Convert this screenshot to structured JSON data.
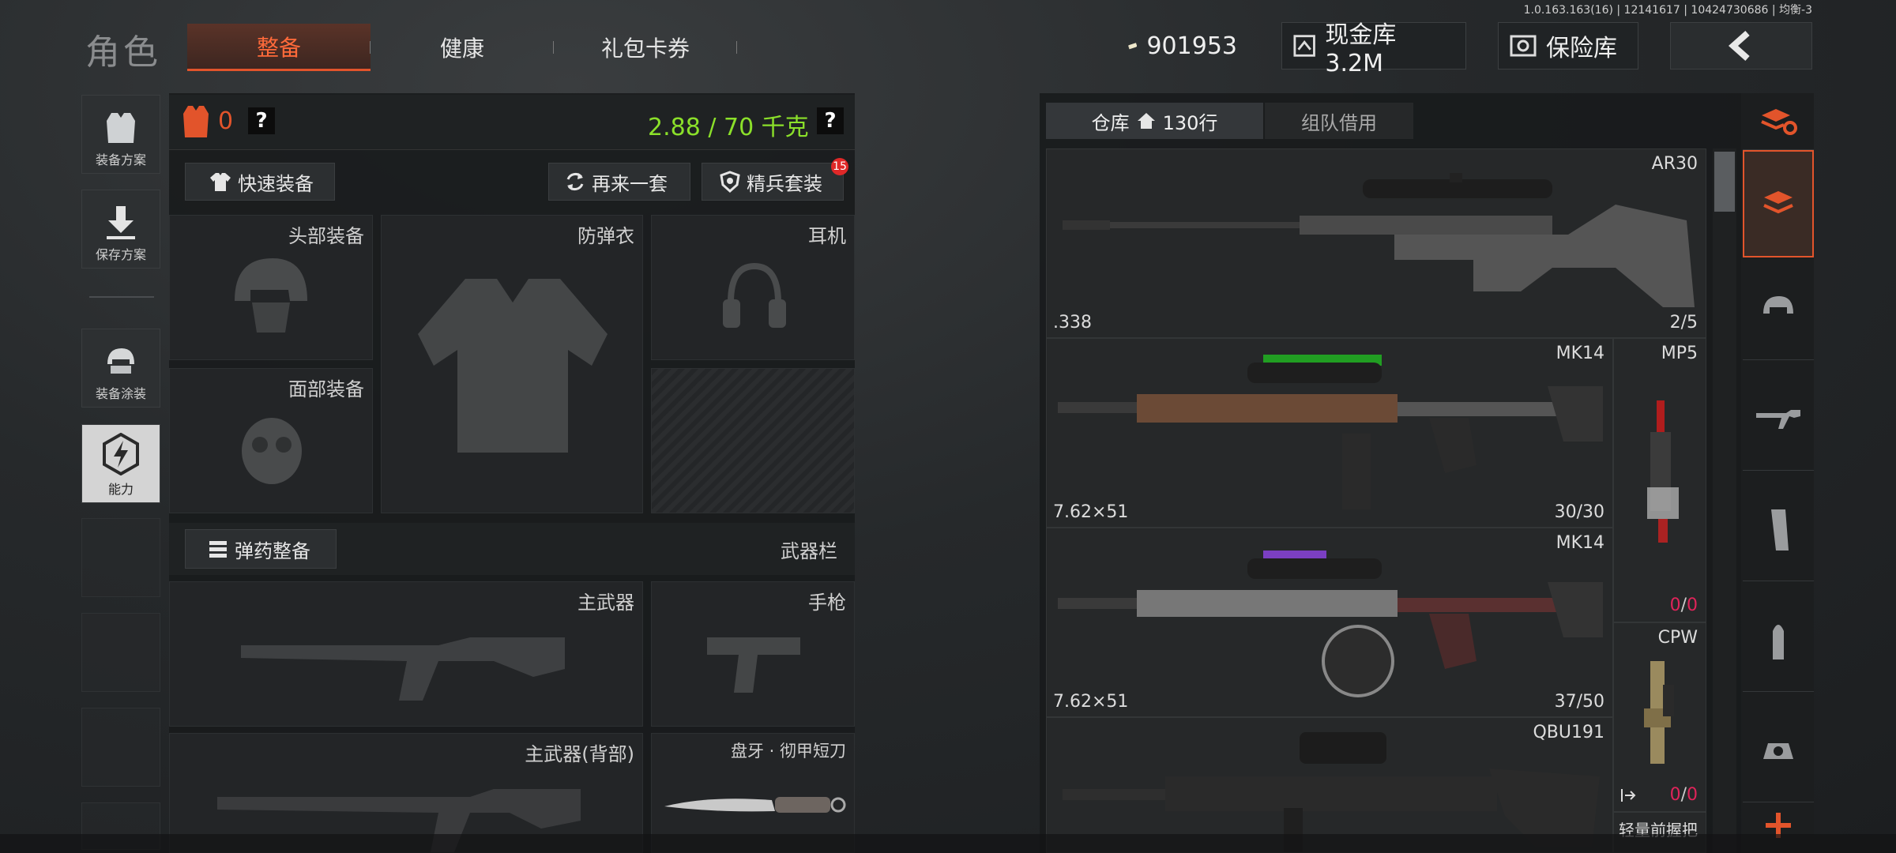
{
  "header": {
    "page_title": "角色",
    "tabs": [
      {
        "label": "整备",
        "active": true
      },
      {
        "label": "健康",
        "active": false
      },
      {
        "label": "礼包卡券",
        "active": false
      }
    ],
    "version_text": "1.0.163.163(16) | 12141617 | 10424730686 | 均衡-3",
    "money": "901953",
    "cash_vault": "现金库 3.2M",
    "safe_box": "保险库",
    "accent_color": "#e2542b"
  },
  "sidebar": {
    "items": [
      {
        "label": "装备方案",
        "icon": "vest-icon"
      },
      {
        "label": "保存方案",
        "icon": "download-icon"
      },
      {
        "label": "装备涂装",
        "icon": "helmet-icon"
      },
      {
        "label": "能力",
        "icon": "lightning-icon"
      }
    ]
  },
  "loadout": {
    "armor_count": "0",
    "help_mark": "?",
    "weight": "2.88 / 70 千克",
    "quick_equip": "快速装备",
    "again": "再来一套",
    "elite_kit": "精兵套装",
    "elite_badge": "15",
    "slots": {
      "head": "头部装备",
      "vest": "防弹衣",
      "headset": "耳机",
      "face": "面部装备",
      "primary": "主武器",
      "pistol": "手枪",
      "primary_back": "主武器(背部)",
      "melee": "盘牙 · 彻甲短刀"
    },
    "ammo_equip": "弹药整备",
    "weapon_bar": "武器栏"
  },
  "inventory": {
    "tab_warehouse": "仓库",
    "rows": "130行",
    "tab_team": "组队借用",
    "items": [
      {
        "name": "AR30",
        "caliber": ".338",
        "count": "2/5"
      },
      {
        "name": "MK14",
        "caliber": "7.62×51",
        "count": "30/30"
      },
      {
        "name": "MP5",
        "caliber": "",
        "count_a": "0",
        "count_b": "0"
      },
      {
        "name": "MK14",
        "caliber": "7.62×51",
        "count": "37/50"
      },
      {
        "name": "CPW",
        "caliber": "",
        "count_a": "0",
        "count_b": "0"
      },
      {
        "name": "QBU191",
        "caliber": "",
        "count": ""
      },
      {
        "name": "轻量前握把",
        "caliber": "",
        "count": ""
      }
    ]
  },
  "categories": [
    "refresh-stack-icon",
    "stack-icon",
    "helmet-icon",
    "rifle-icon",
    "magazine-icon",
    "bullet-icon",
    "scope-icon",
    "plus-icon"
  ]
}
